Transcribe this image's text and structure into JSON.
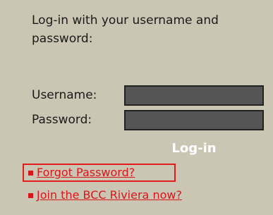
{
  "login": {
    "intro_text": "Log-in with your username and password:",
    "username_label": "Username:",
    "username_value": "",
    "password_label": "Password:",
    "password_value": "",
    "submit_label": "Log-in"
  },
  "links": {
    "forgot_password": "Forgot Password?",
    "join": "Join the BCC Riviera now?"
  },
  "colors": {
    "background": "#cbc6b3",
    "input_fill": "#555555",
    "link_red": "#d8161b",
    "focus_border": "#e21b1b"
  },
  "icons": {
    "link_bullet": "red-square-bullet-icon"
  }
}
